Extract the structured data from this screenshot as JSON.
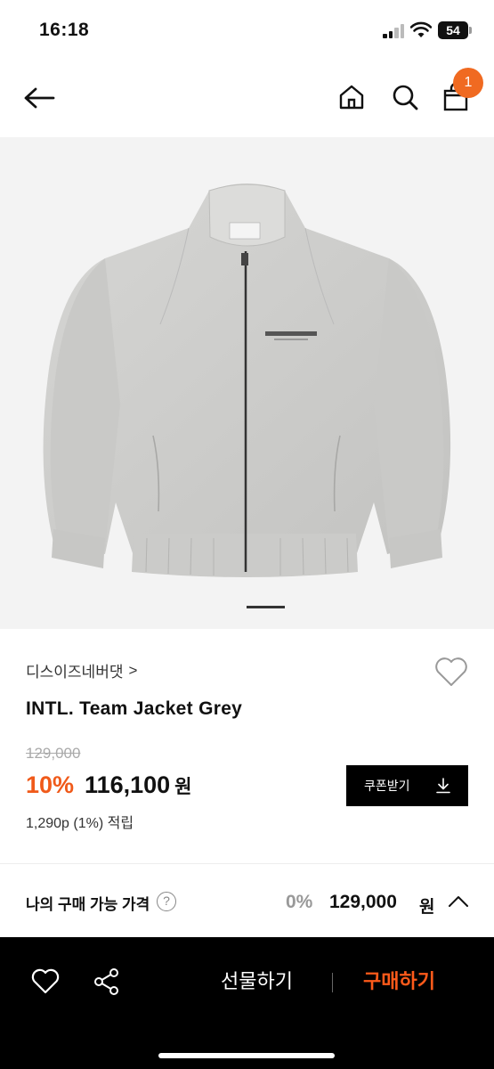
{
  "status_bar": {
    "time": "16:18",
    "battery": "54"
  },
  "nav": {
    "cart_count": "1",
    "icons": [
      "back-arrow-icon",
      "home-icon",
      "search-icon",
      "bag-icon"
    ]
  },
  "product": {
    "brand": "디스이즈네버댓",
    "brand_chevron": ">",
    "name": "INTL. Team Jacket Grey",
    "original_price": "129,000",
    "discount": "10%",
    "sale_price": "116,100",
    "currency": "원",
    "points": "1,290p (1%) 적립",
    "coupon_label": "쿠폰받기",
    "image_count": 1,
    "current_image": 1
  },
  "available_price": {
    "label": "나의 구매 가능 가격",
    "help": "?",
    "percent": "0%",
    "price": "129,000",
    "currency": "원"
  },
  "bottom_bar": {
    "gift_label": "선물하기",
    "buy_label": "구매하기"
  },
  "colors": {
    "accent": "#f05a1a",
    "badge": "#f06a21",
    "jacket": "#cfcfcd",
    "bar": "#000000"
  }
}
